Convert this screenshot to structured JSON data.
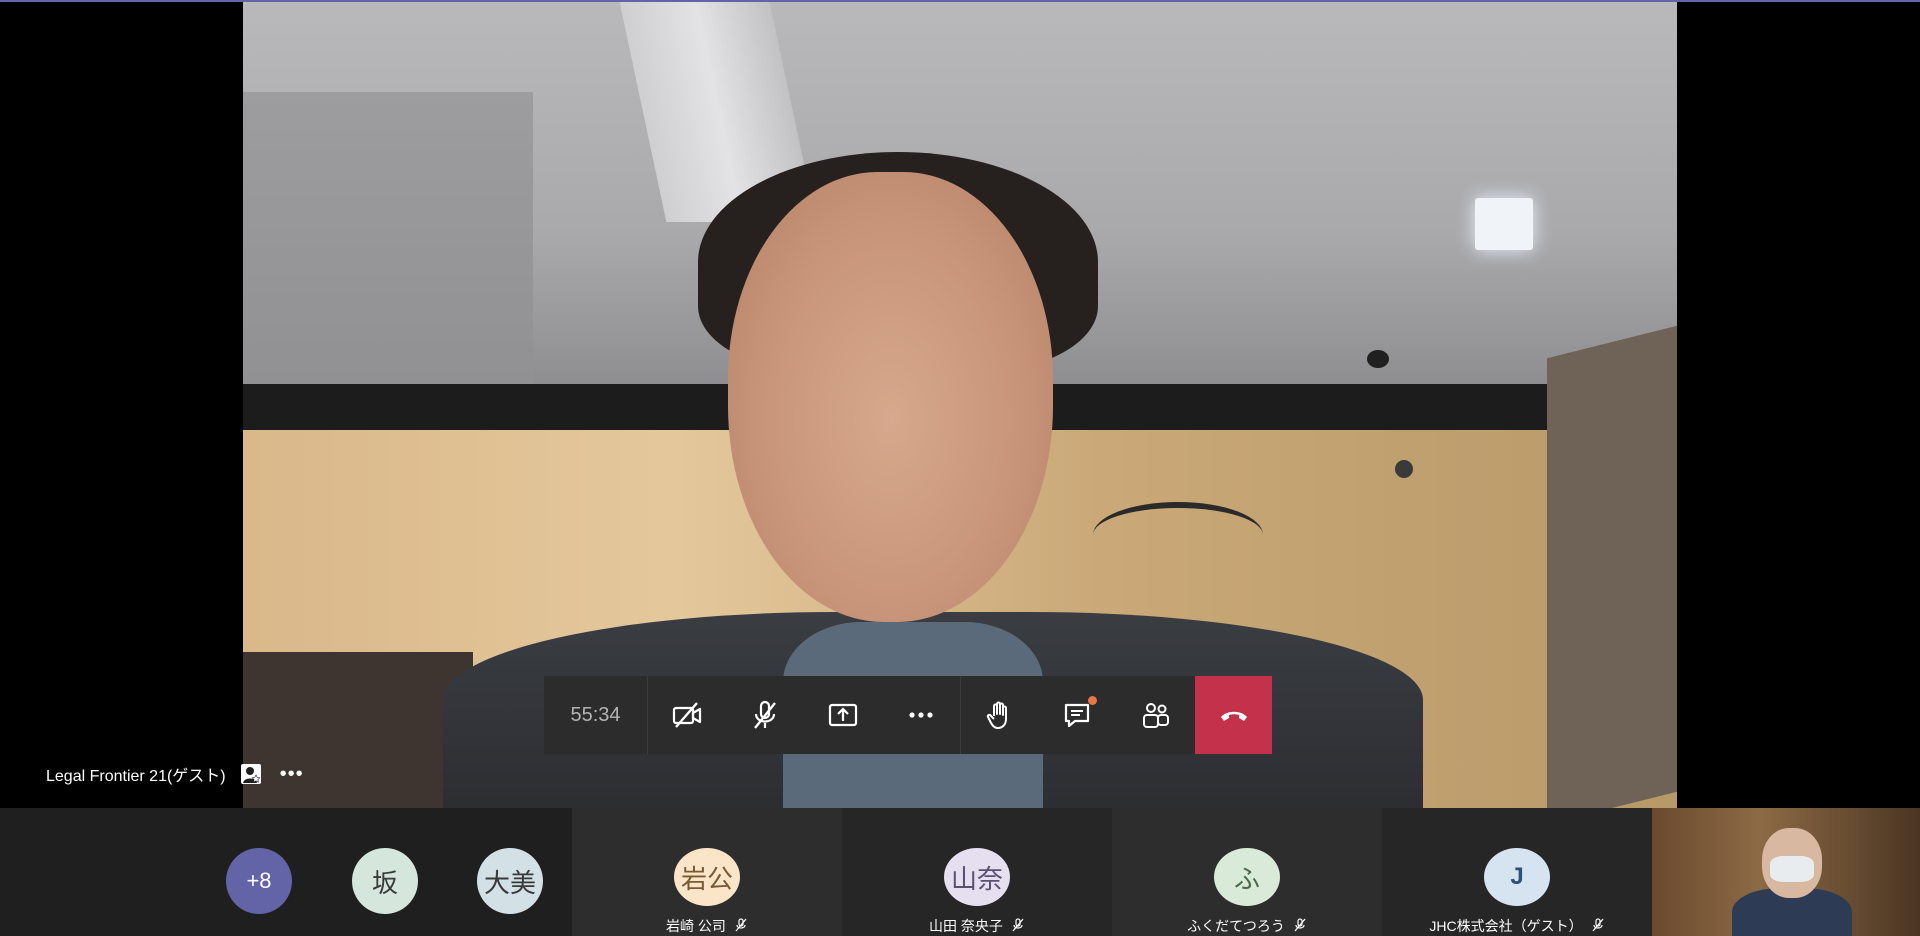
{
  "call": {
    "timer": "55:34",
    "active_speaker_name": "Legal Frontier 21(ゲスト)"
  },
  "controls": {
    "camera_icon": "camera-off-icon",
    "mic_icon": "mic-off-icon",
    "share_icon": "share-screen-icon",
    "more_icon": "more-actions-icon",
    "raise_hand_icon": "raise-hand-icon",
    "chat_icon": "chat-icon",
    "participants_icon": "participants-icon",
    "hangup_icon": "hang-up-icon"
  },
  "participants": {
    "overflow_count": "+8",
    "small": [
      {
        "initials": "坂",
        "color": "#d5e6dc"
      },
      {
        "initials": "大美",
        "color": "#d3e0e6"
      }
    ],
    "tiles": [
      {
        "initials": "岩公",
        "name": "岩崎 公司",
        "color": "#fbe5c8"
      },
      {
        "initials": "山奈",
        "name": "山田 奈央子",
        "color": "#e5dff0"
      },
      {
        "initials": "ふ",
        "name": "ふくだてつろう",
        "color": "#d9ead9"
      },
      {
        "initials": "J",
        "name": "JHC株式会社（ゲスト）",
        "color": "#d6e4f2"
      }
    ]
  },
  "colors": {
    "accent": "#6264a7",
    "hangup": "#c4314b",
    "notification": "#e97548"
  }
}
